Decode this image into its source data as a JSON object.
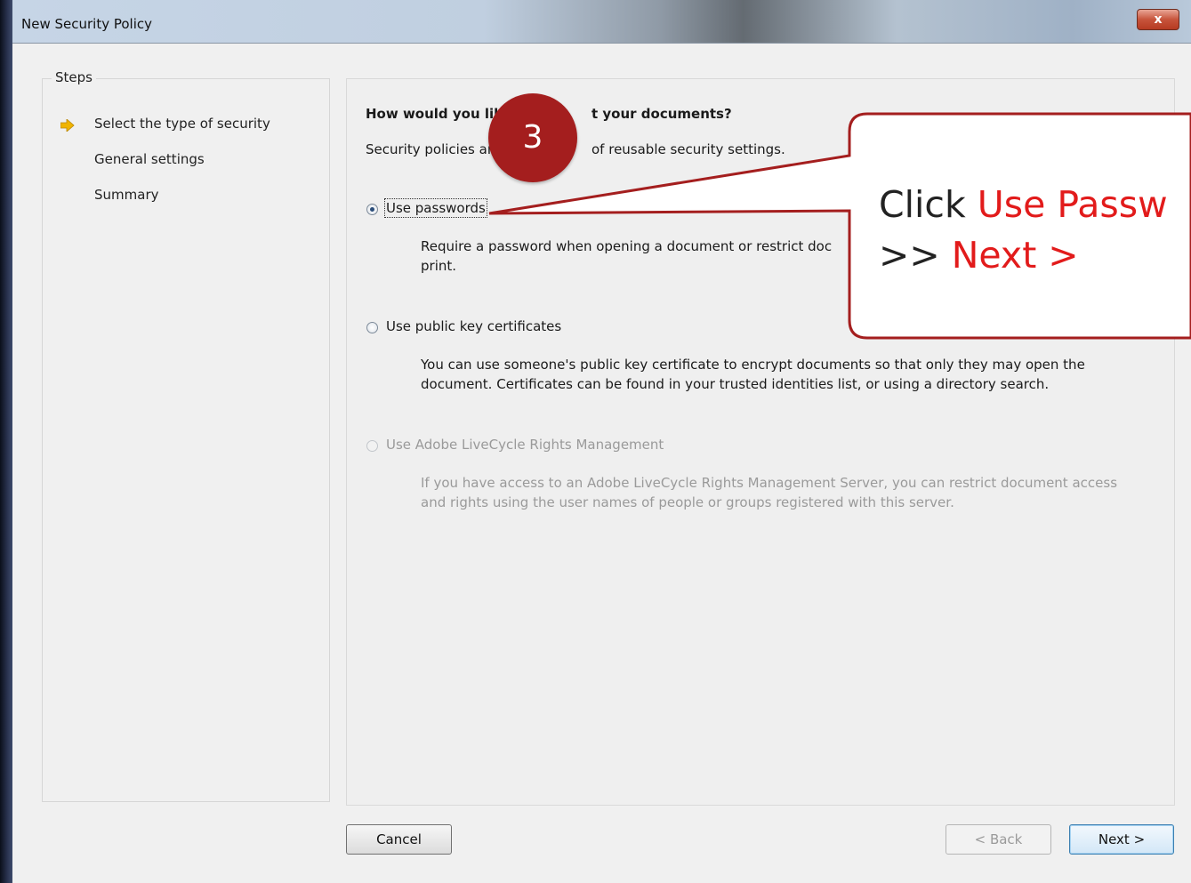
{
  "window": {
    "title": "New Security Policy",
    "close_label": "x"
  },
  "steps": {
    "title": "Steps",
    "items": [
      {
        "label": "Select the type of security",
        "current": true
      },
      {
        "label": "General settings",
        "current": false
      },
      {
        "label": "Summary",
        "current": false
      }
    ]
  },
  "content": {
    "question_part1": "How would you lik",
    "question_part2": "t your documents?",
    "intro_part1": "Security policies ar",
    "intro_part2": "of reusable security settings.",
    "options": [
      {
        "label": "Use passwords",
        "selected": true,
        "enabled": true,
        "desc_line1": "Require a password when opening a document or restrict doc",
        "desc_line2": "print."
      },
      {
        "label": "Use public key certificates",
        "selected": false,
        "enabled": true,
        "desc_line1": "You can use someone's public key certificate to encrypt documents so that only they may open the",
        "desc_line2": "document. Certificates can be found in your trusted identities list, or using a directory search."
      },
      {
        "label": "Use Adobe LiveCycle Rights Management",
        "selected": false,
        "enabled": false,
        "desc_line1": "If you have access to an Adobe LiveCycle Rights Management Server, you can restrict document access",
        "desc_line2": "and rights using the user names of people or groups registered with this server."
      }
    ]
  },
  "buttons": {
    "cancel": "Cancel",
    "back": "< Back",
    "next": "Next >"
  },
  "annotation": {
    "badge_number": "3",
    "line1_prefix": "Click ",
    "line1_highlight": "Use Passw",
    "line2_prefix": ">> ",
    "line2_highlight": "Next >",
    "accent_color": "#e21b1b",
    "callout_border": "#a41e1e"
  }
}
